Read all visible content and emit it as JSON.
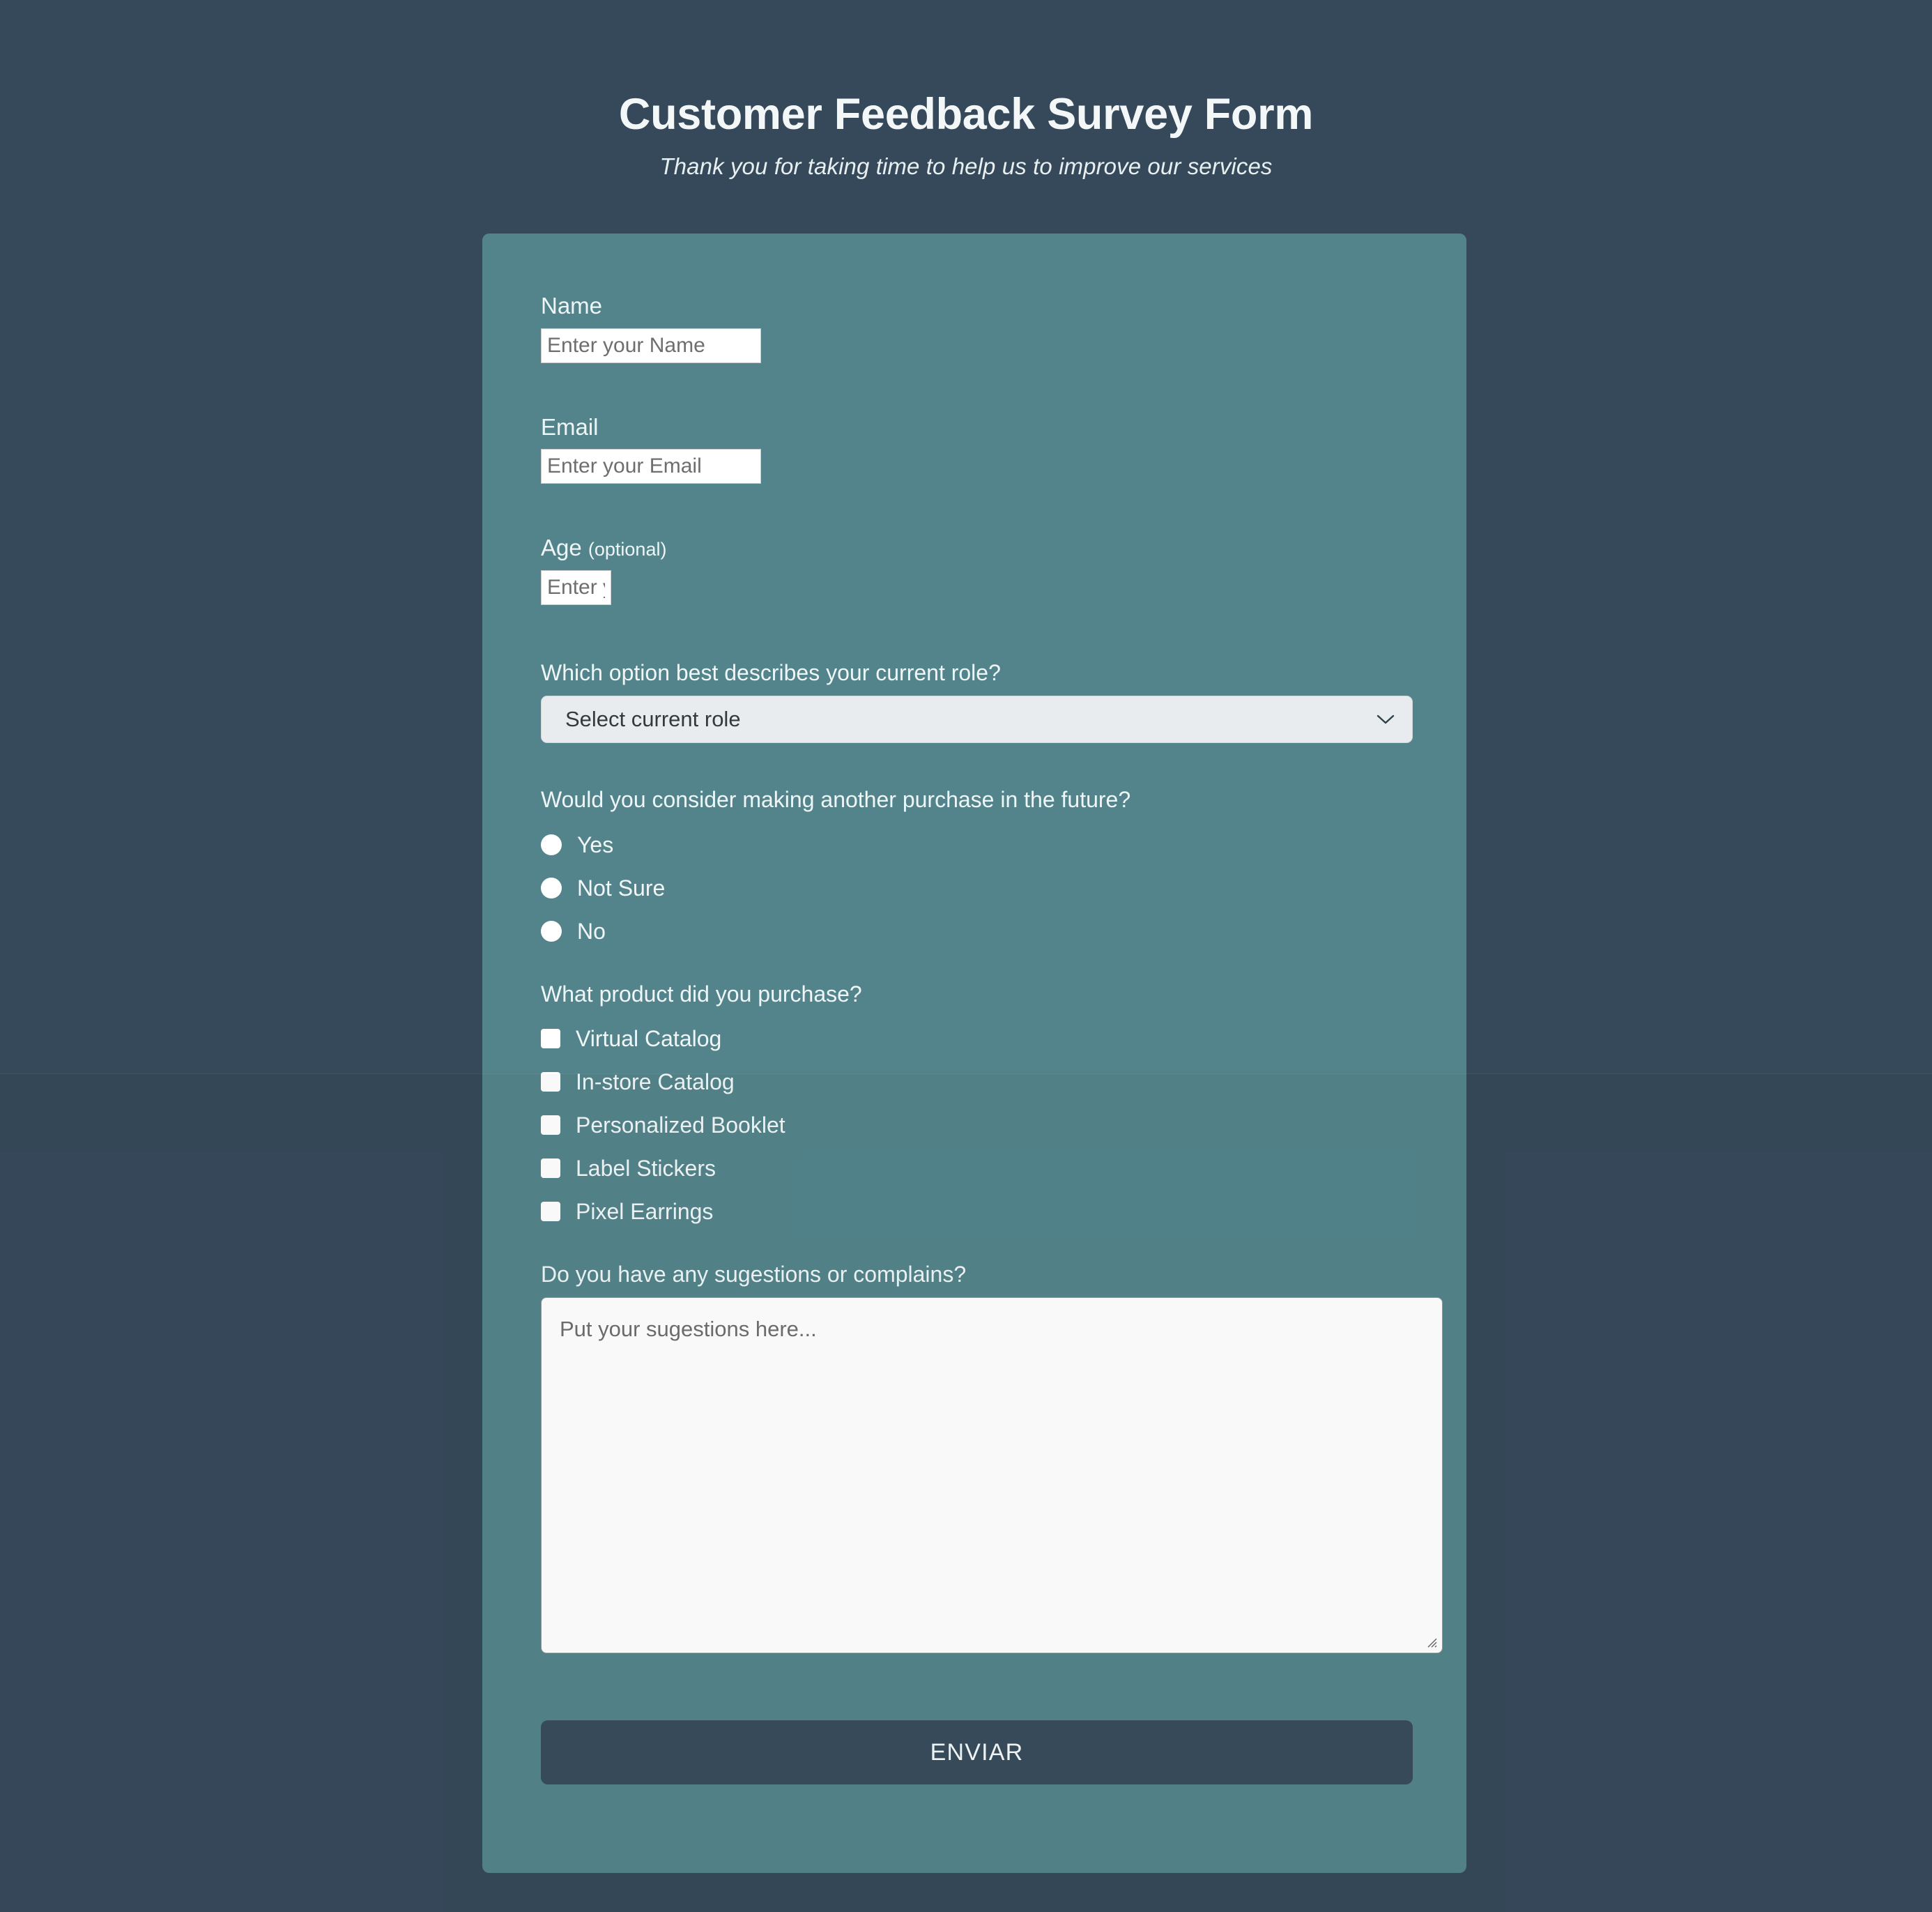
{
  "header": {
    "title": "Customer Feedback Survey Form",
    "subtitle": "Thank you for taking time to help us to improve our services"
  },
  "colors": {
    "page_background": "#36495a",
    "card_background": "#53848b",
    "submit_background": "#384c5c",
    "select_background": "#e9ecef",
    "input_background": "#ffffff",
    "label_text": "#eef5f6"
  },
  "form": {
    "name_field": {
      "label": "Name",
      "placeholder": "Enter your Name",
      "value": ""
    },
    "email_field": {
      "label": "Email",
      "placeholder": "Enter your Email",
      "value": ""
    },
    "age_field": {
      "label": "Age",
      "label_suffix": "(optional)",
      "placeholder": "Enter your Age",
      "value": ""
    },
    "role_question": {
      "label": "Which option best describes your current role?",
      "selected": "Select current role",
      "options": [
        "Select current role"
      ],
      "icon": "chevron-down-icon"
    },
    "purchase_question": {
      "label": "Would you consider making another purchase in the future?",
      "options": [
        {
          "label": "Yes",
          "checked": false
        },
        {
          "label": "Not Sure",
          "checked": false
        },
        {
          "label": "No",
          "checked": false
        }
      ]
    },
    "product_question": {
      "label": "What product did you purchase?",
      "options": [
        {
          "label": "Virtual Catalog",
          "checked": false
        },
        {
          "label": "In-store Catalog",
          "checked": false
        },
        {
          "label": "Personalized Booklet",
          "checked": false
        },
        {
          "label": "Label Stickers",
          "checked": false
        },
        {
          "label": "Pixel Earrings",
          "checked": false
        }
      ]
    },
    "suggestions_question": {
      "label": "Do you have any sugestions or complains?",
      "placeholder": "Put your sugestions here...",
      "value": "",
      "icon": "resize-grip-icon"
    },
    "submit_button": {
      "label": "ENVIAR"
    }
  }
}
